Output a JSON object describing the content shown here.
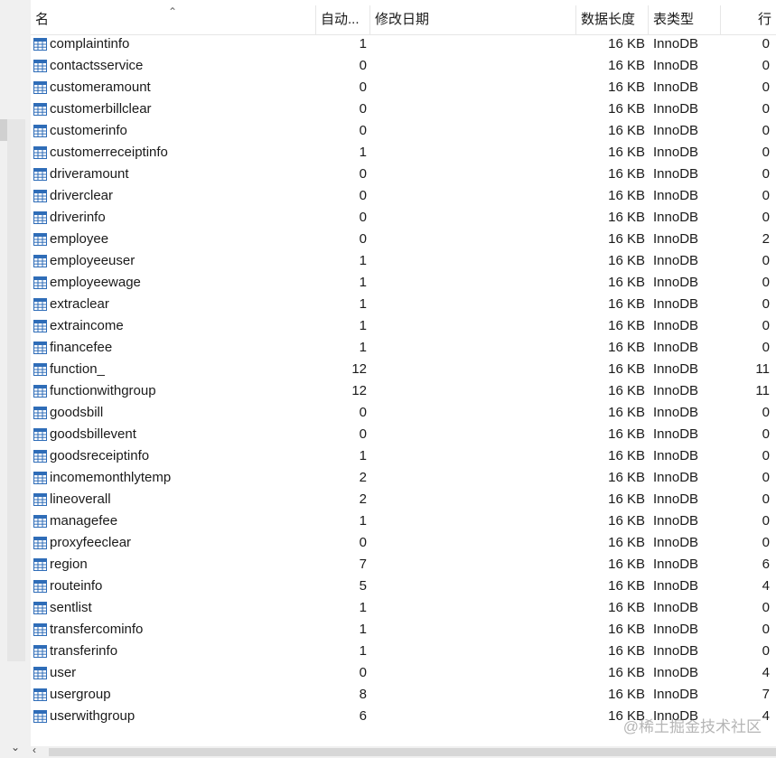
{
  "columns": {
    "name": "名",
    "auto": "自动...",
    "modified": "修改日期",
    "size": "数据长度",
    "type": "表类型",
    "rows": "行"
  },
  "tables": [
    {
      "name": "complaintinfo",
      "auto": "1",
      "size": "16 KB",
      "type": "InnoDB",
      "rows": "0"
    },
    {
      "name": "contactsservice",
      "auto": "0",
      "size": "16 KB",
      "type": "InnoDB",
      "rows": "0"
    },
    {
      "name": "customeramount",
      "auto": "0",
      "size": "16 KB",
      "type": "InnoDB",
      "rows": "0"
    },
    {
      "name": "customerbillclear",
      "auto": "0",
      "size": "16 KB",
      "type": "InnoDB",
      "rows": "0"
    },
    {
      "name": "customerinfo",
      "auto": "0",
      "size": "16 KB",
      "type": "InnoDB",
      "rows": "0"
    },
    {
      "name": "customerreceiptinfo",
      "auto": "1",
      "size": "16 KB",
      "type": "InnoDB",
      "rows": "0"
    },
    {
      "name": "driveramount",
      "auto": "0",
      "size": "16 KB",
      "type": "InnoDB",
      "rows": "0"
    },
    {
      "name": "driverclear",
      "auto": "0",
      "size": "16 KB",
      "type": "InnoDB",
      "rows": "0"
    },
    {
      "name": "driverinfo",
      "auto": "0",
      "size": "16 KB",
      "type": "InnoDB",
      "rows": "0"
    },
    {
      "name": "employee",
      "auto": "0",
      "size": "16 KB",
      "type": "InnoDB",
      "rows": "2"
    },
    {
      "name": "employeeuser",
      "auto": "1",
      "size": "16 KB",
      "type": "InnoDB",
      "rows": "0"
    },
    {
      "name": "employeewage",
      "auto": "1",
      "size": "16 KB",
      "type": "InnoDB",
      "rows": "0"
    },
    {
      "name": "extraclear",
      "auto": "1",
      "size": "16 KB",
      "type": "InnoDB",
      "rows": "0"
    },
    {
      "name": "extraincome",
      "auto": "1",
      "size": "16 KB",
      "type": "InnoDB",
      "rows": "0"
    },
    {
      "name": "financefee",
      "auto": "1",
      "size": "16 KB",
      "type": "InnoDB",
      "rows": "0"
    },
    {
      "name": "function_",
      "auto": "12",
      "size": "16 KB",
      "type": "InnoDB",
      "rows": "11"
    },
    {
      "name": "functionwithgroup",
      "auto": "12",
      "size": "16 KB",
      "type": "InnoDB",
      "rows": "11"
    },
    {
      "name": "goodsbill",
      "auto": "0",
      "size": "16 KB",
      "type": "InnoDB",
      "rows": "0"
    },
    {
      "name": "goodsbillevent",
      "auto": "0",
      "size": "16 KB",
      "type": "InnoDB",
      "rows": "0"
    },
    {
      "name": "goodsreceiptinfo",
      "auto": "1",
      "size": "16 KB",
      "type": "InnoDB",
      "rows": "0"
    },
    {
      "name": "incomemonthlytemp",
      "auto": "2",
      "size": "16 KB",
      "type": "InnoDB",
      "rows": "0"
    },
    {
      "name": "lineoverall",
      "auto": "2",
      "size": "16 KB",
      "type": "InnoDB",
      "rows": "0"
    },
    {
      "name": "managefee",
      "auto": "1",
      "size": "16 KB",
      "type": "InnoDB",
      "rows": "0"
    },
    {
      "name": "proxyfeeclear",
      "auto": "0",
      "size": "16 KB",
      "type": "InnoDB",
      "rows": "0"
    },
    {
      "name": "region",
      "auto": "7",
      "size": "16 KB",
      "type": "InnoDB",
      "rows": "6"
    },
    {
      "name": "routeinfo",
      "auto": "5",
      "size": "16 KB",
      "type": "InnoDB",
      "rows": "4"
    },
    {
      "name": "sentlist",
      "auto": "1",
      "size": "16 KB",
      "type": "InnoDB",
      "rows": "0"
    },
    {
      "name": "transfercominfo",
      "auto": "1",
      "size": "16 KB",
      "type": "InnoDB",
      "rows": "0"
    },
    {
      "name": "transferinfo",
      "auto": "1",
      "size": "16 KB",
      "type": "InnoDB",
      "rows": "0"
    },
    {
      "name": "user",
      "auto": "0",
      "size": "16 KB",
      "type": "InnoDB",
      "rows": "4"
    },
    {
      "name": "usergroup",
      "auto": "8",
      "size": "16 KB",
      "type": "InnoDB",
      "rows": "7"
    },
    {
      "name": "userwithgroup",
      "auto": "6",
      "size": "16 KB",
      "type": "InnoDB",
      "rows": "4"
    }
  ],
  "icons": {
    "table": "table-icon",
    "sort": "sort-ascending-icon"
  },
  "colors": {
    "table_icon": "#2f6db8",
    "grid": "#e6e6e6",
    "watermark": "#9a9a9a"
  },
  "watermark": "@稀土掘金技术社区"
}
